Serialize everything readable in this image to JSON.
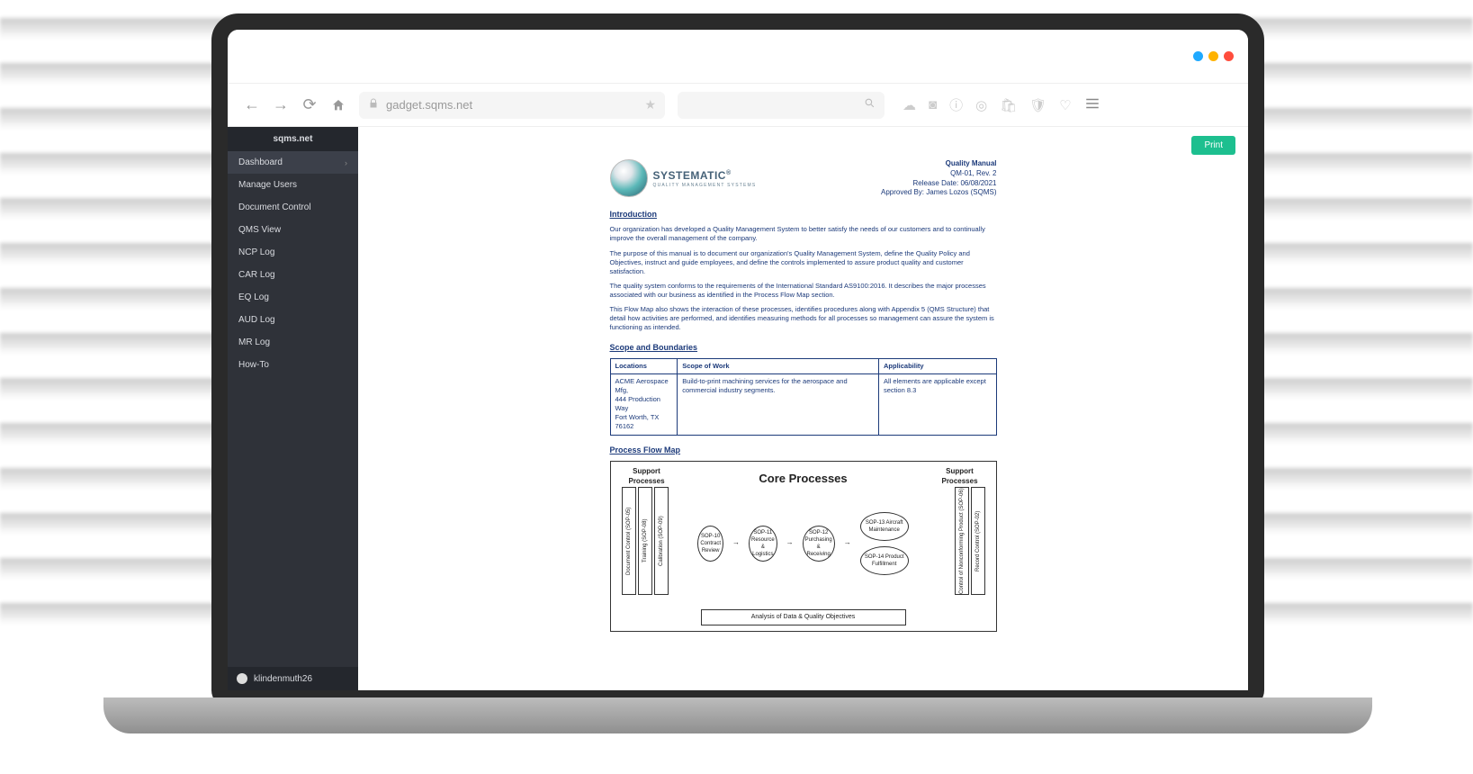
{
  "browser": {
    "url": "gadget.sqms.net"
  },
  "sidebar": {
    "title": "sqms.net",
    "items": [
      {
        "label": "Dashboard",
        "active": true,
        "expand": true
      },
      {
        "label": "Manage Users"
      },
      {
        "label": "Document Control"
      },
      {
        "label": "QMS View"
      },
      {
        "label": "NCP Log"
      },
      {
        "label": "CAR Log"
      },
      {
        "label": "EQ Log"
      },
      {
        "label": "AUD Log"
      },
      {
        "label": "MR Log"
      },
      {
        "label": "How-To"
      }
    ],
    "user": "klindenmuth26"
  },
  "buttons": {
    "print": "Print"
  },
  "doc": {
    "logo": {
      "line1": "SYSTEMATIC",
      "line2": "QUALITY MANAGEMENT SYSTEMS",
      "reg": "®"
    },
    "meta": {
      "title": "Quality Manual",
      "id": "QM-01, Rev. 2",
      "release": "Release Date: 06/08/2021",
      "approved": "Approved By: James Lozos (SQMS)"
    },
    "h_intro": "Introduction",
    "p1": "Our organization has developed a Quality Management System to better satisfy the needs of our customers and to continually improve the overall management of the company.",
    "p2": "The purpose of this manual is to document our organization's Quality Management System, define the Quality Policy and Objectives, instruct and guide employees, and define the controls implemented to assure product quality and customer satisfaction.",
    "p3": "The quality system conforms to the requirements of the International Standard AS9100:2016. It describes the major processes associated with our business as identified in the Process Flow Map section.",
    "p4": "This Flow Map also shows the interaction of these processes, identifies procedures along with Appendix 5 (QMS Structure) that detail how activities are performed, and identifies measuring methods for all processes so management can assure the system is functioning as intended.",
    "h_scope": "Scope and Boundaries",
    "table": {
      "h1": "Locations",
      "h2": "Scope of Work",
      "h3": "Applicability",
      "c1": "ACME Aerospace Mfg,\n444 Production Way\nFort Worth, TX 76162",
      "c2": "Build-to-print machining services for the aerospace and commercial industry segments.",
      "c3": "All elements are applicable except section 8.3"
    },
    "h_flow": "Process Flow Map",
    "flow": {
      "support": "Support Processes",
      "core": "Core Processes",
      "leftcols": [
        "Document Control (SOP-05)",
        "Training (SOP-08)",
        "Calibration (SOP-09)"
      ],
      "rightcols": [
        "Record Control (SOP-02)",
        "Control of Nonconforming Product (SOP-06)"
      ],
      "ovals": {
        "o1": "SOP-10 Contract Review",
        "o2": "SOP-11 Resource & Logistics",
        "o3": "SOP-12 Purchasing & Receiving",
        "o4": "SOP-13 Aircraft Maintenance",
        "o5": "SOP-14 Product Fulfillment"
      },
      "analysis": "Analysis of Data & Quality Objectives"
    }
  }
}
